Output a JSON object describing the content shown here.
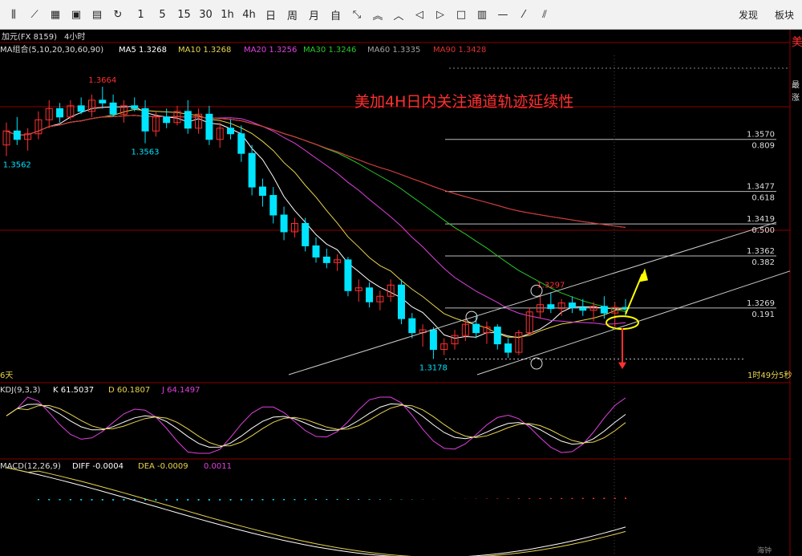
{
  "toolbar": {
    "icons": [
      "candle-icon",
      "line-icon",
      "grid-icon",
      "image-icon",
      "save-icon",
      "refresh-icon"
    ],
    "periods": [
      "1",
      "5",
      "15",
      "30",
      "1h",
      "4h",
      "日",
      "周",
      "月",
      "自"
    ],
    "nav_icons": [
      "shrink-icon",
      "chevron-up-double-icon",
      "chevron-up-icon",
      "arrow-left-icon",
      "arrow-right-icon",
      "square-icon",
      "columns-icon",
      "line-draw-icon",
      "diagonal-icon",
      "parallel-icon"
    ],
    "discover_label": "发现",
    "block_label": "板块"
  },
  "header": {
    "symbol": "加元(FX 8159)",
    "period": "4小时",
    "right_char": "美"
  },
  "ma_legend": {
    "title": "MA组合(5,10,20,30,60,90)",
    "items": [
      {
        "label": "MA5 1.3268",
        "color": "#ffffff"
      },
      {
        "label": "MA10 1.3268",
        "color": "#e8d44d"
      },
      {
        "label": "MA20 1.3256",
        "color": "#e040e0"
      },
      {
        "label": "MA30 1.3246",
        "color": "#28c828"
      },
      {
        "label": "MA60 1.3335",
        "color": "#a0a0a0"
      },
      {
        "label": "MA90 1.3428",
        "color": "#e03030"
      }
    ]
  },
  "annotation": "美加4H日内关注通道轨迹延续性",
  "price_labels": {
    "high": "1.3664",
    "low_left": "1.3562",
    "low_mid": "1.3563",
    "low": "1.3178",
    "swing": "1.3297"
  },
  "fib_levels": [
    {
      "price": "1.3570",
      "ratio": "0.809"
    },
    {
      "price": "1.3477",
      "ratio": "0.618"
    },
    {
      "price": "1.3419",
      "ratio": "0.500"
    },
    {
      "price": "1.3362",
      "ratio": "0.382"
    },
    {
      "price": "1.3269",
      "ratio": "0.191"
    }
  ],
  "right_axis_chars": [
    "最",
    "涨"
  ],
  "countdown": "1时49分5秒",
  "days_label": "6天",
  "kdj": {
    "title": "KDJ(9,3,3)",
    "k": "K 61.5037",
    "d": "D 60.1807",
    "j": "J 64.1497"
  },
  "macd": {
    "title": "MACD(12,26,9)",
    "diff": "DIFF -0.0004",
    "dea": "DEA -0.0009",
    "macd": "0.0011"
  },
  "bottom_right": "海钟",
  "colors": {
    "up": "#ff3030",
    "down": "#00e5ff",
    "grid": "#8b0000",
    "annotation": "#ff3030",
    "highlight": "#ffff00"
  },
  "chart_data": {
    "type": "candlestick",
    "title": "美加4H日内关注通道轨迹延续性",
    "series_note": "USD/CAD 4-hour candles (approximate)",
    "candles": [
      {
        "o": 1.356,
        "h": 1.36,
        "l": 1.354,
        "c": 1.3585
      },
      {
        "o": 1.3585,
        "h": 1.361,
        "l": 1.356,
        "c": 1.357
      },
      {
        "o": 1.357,
        "h": 1.359,
        "l": 1.355,
        "c": 1.358
      },
      {
        "o": 1.358,
        "h": 1.362,
        "l": 1.357,
        "c": 1.3605
      },
      {
        "o": 1.3605,
        "h": 1.364,
        "l": 1.359,
        "c": 1.3625
      },
      {
        "o": 1.3625,
        "h": 1.3635,
        "l": 1.36,
        "c": 1.361
      },
      {
        "o": 1.361,
        "h": 1.364,
        "l": 1.3605,
        "c": 1.363
      },
      {
        "o": 1.363,
        "h": 1.3645,
        "l": 1.3615,
        "c": 1.362
      },
      {
        "o": 1.362,
        "h": 1.365,
        "l": 1.361,
        "c": 1.364
      },
      {
        "o": 1.364,
        "h": 1.3664,
        "l": 1.3625,
        "c": 1.3635
      },
      {
        "o": 1.3635,
        "h": 1.365,
        "l": 1.361,
        "c": 1.3615
      },
      {
        "o": 1.3615,
        "h": 1.364,
        "l": 1.36,
        "c": 1.363
      },
      {
        "o": 1.363,
        "h": 1.3645,
        "l": 1.362,
        "c": 1.3625
      },
      {
        "o": 1.3625,
        "h": 1.364,
        "l": 1.3563,
        "c": 1.3585
      },
      {
        "o": 1.3585,
        "h": 1.362,
        "l": 1.3575,
        "c": 1.361
      },
      {
        "o": 1.361,
        "h": 1.3625,
        "l": 1.359,
        "c": 1.36
      },
      {
        "o": 1.36,
        "h": 1.363,
        "l": 1.3595,
        "c": 1.362
      },
      {
        "o": 1.362,
        "h": 1.364,
        "l": 1.358,
        "c": 1.359
      },
      {
        "o": 1.359,
        "h": 1.3625,
        "l": 1.358,
        "c": 1.3615
      },
      {
        "o": 1.3615,
        "h": 1.363,
        "l": 1.356,
        "c": 1.357
      },
      {
        "o": 1.357,
        "h": 1.36,
        "l": 1.3555,
        "c": 1.359
      },
      {
        "o": 1.359,
        "h": 1.3605,
        "l": 1.357,
        "c": 1.358
      },
      {
        "o": 1.358,
        "h": 1.3595,
        "l": 1.353,
        "c": 1.3545
      },
      {
        "o": 1.3545,
        "h": 1.356,
        "l": 1.347,
        "c": 1.3485
      },
      {
        "o": 1.3485,
        "h": 1.35,
        "l": 1.345,
        "c": 1.347
      },
      {
        "o": 1.347,
        "h": 1.3485,
        "l": 1.342,
        "c": 1.3435
      },
      {
        "o": 1.3435,
        "h": 1.345,
        "l": 1.339,
        "c": 1.3405
      },
      {
        "o": 1.3405,
        "h": 1.343,
        "l": 1.3395,
        "c": 1.342
      },
      {
        "o": 1.342,
        "h": 1.343,
        "l": 1.337,
        "c": 1.338
      },
      {
        "o": 1.338,
        "h": 1.3395,
        "l": 1.335,
        "c": 1.336
      },
      {
        "o": 1.336,
        "h": 1.3375,
        "l": 1.334,
        "c": 1.335
      },
      {
        "o": 1.335,
        "h": 1.3365,
        "l": 1.3335,
        "c": 1.3355
      },
      {
        "o": 1.3355,
        "h": 1.336,
        "l": 1.329,
        "c": 1.33
      },
      {
        "o": 1.33,
        "h": 1.332,
        "l": 1.328,
        "c": 1.3305
      },
      {
        "o": 1.3305,
        "h": 1.3315,
        "l": 1.327,
        "c": 1.328
      },
      {
        "o": 1.328,
        "h": 1.33,
        "l": 1.3265,
        "c": 1.329
      },
      {
        "o": 1.329,
        "h": 1.332,
        "l": 1.328,
        "c": 1.331
      },
      {
        "o": 1.331,
        "h": 1.332,
        "l": 1.324,
        "c": 1.325
      },
      {
        "o": 1.325,
        "h": 1.326,
        "l": 1.3215,
        "c": 1.3225
      },
      {
        "o": 1.3225,
        "h": 1.324,
        "l": 1.32,
        "c": 1.323
      },
      {
        "o": 1.323,
        "h": 1.3235,
        "l": 1.3178,
        "c": 1.3195
      },
      {
        "o": 1.3195,
        "h": 1.3215,
        "l": 1.3185,
        "c": 1.3205
      },
      {
        "o": 1.3205,
        "h": 1.323,
        "l": 1.3195,
        "c": 1.322
      },
      {
        "o": 1.322,
        "h": 1.325,
        "l": 1.321,
        "c": 1.324
      },
      {
        "o": 1.324,
        "h": 1.3255,
        "l": 1.3215,
        "c": 1.3225
      },
      {
        "o": 1.3225,
        "h": 1.3245,
        "l": 1.3205,
        "c": 1.3235
      },
      {
        "o": 1.3235,
        "h": 1.324,
        "l": 1.3195,
        "c": 1.3205
      },
      {
        "o": 1.3205,
        "h": 1.3215,
        "l": 1.318,
        "c": 1.319
      },
      {
        "o": 1.319,
        "h": 1.323,
        "l": 1.3185,
        "c": 1.3225
      },
      {
        "o": 1.3225,
        "h": 1.327,
        "l": 1.322,
        "c": 1.3262
      },
      {
        "o": 1.3262,
        "h": 1.329,
        "l": 1.325,
        "c": 1.3275
      },
      {
        "o": 1.3275,
        "h": 1.3297,
        "l": 1.326,
        "c": 1.3268
      },
      {
        "o": 1.3268,
        "h": 1.3285,
        "l": 1.3255,
        "c": 1.3278
      },
      {
        "o": 1.3278,
        "h": 1.329,
        "l": 1.326,
        "c": 1.327
      },
      {
        "o": 1.327,
        "h": 1.3285,
        "l": 1.3255,
        "c": 1.3265
      },
      {
        "o": 1.3265,
        "h": 1.328,
        "l": 1.3245,
        "c": 1.3272
      },
      {
        "o": 1.3272,
        "h": 1.329,
        "l": 1.325,
        "c": 1.326
      },
      {
        "o": 1.326,
        "h": 1.328,
        "l": 1.3235,
        "c": 1.327
      },
      {
        "o": 1.327,
        "h": 1.3285,
        "l": 1.3255,
        "c": 1.3268
      }
    ],
    "ylim": [
      1.315,
      1.372
    ],
    "fib_retracement": [
      {
        "ratio": 0.809,
        "price": 1.357
      },
      {
        "ratio": 0.618,
        "price": 1.3477
      },
      {
        "ratio": 0.5,
        "price": 1.3419
      },
      {
        "ratio": 0.382,
        "price": 1.3362
      },
      {
        "ratio": 0.191,
        "price": 1.3269
      }
    ],
    "kdj": {
      "k": 61.5037,
      "d": 60.1807,
      "j": 64.1497
    },
    "macd": {
      "diff": -0.0004,
      "dea": -0.0009,
      "macd": 0.0011
    }
  }
}
